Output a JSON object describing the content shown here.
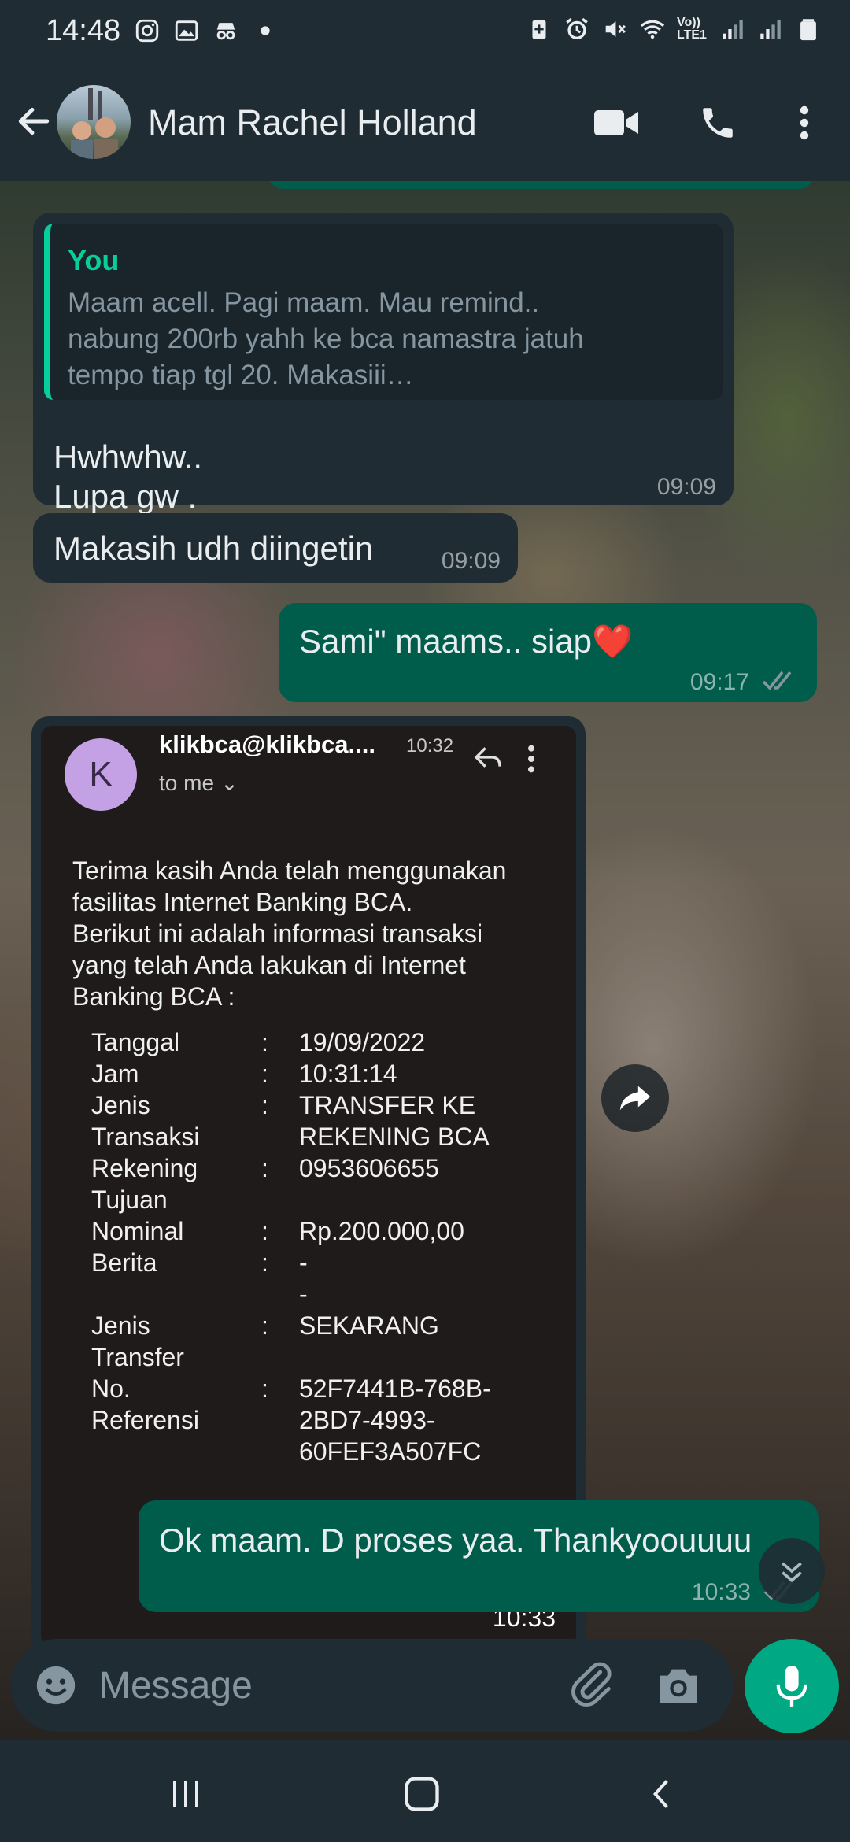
{
  "status_bar": {
    "time": "14:48",
    "left_icons": [
      "instagram-icon",
      "gallery-icon",
      "incognito-icon",
      "dot-icon"
    ],
    "right_icons": [
      "battery-saver-icon",
      "alarm-icon",
      "mute-icon",
      "wifi-icon",
      "volte-icon",
      "signal-icon",
      "signal-icon",
      "battery-icon"
    ],
    "volte_label": "Vo)) LTE1"
  },
  "header": {
    "contact_name": "Mam Rachel Holland",
    "icons": [
      "back-arrow-icon",
      "video-call-icon",
      "phone-icon",
      "more-vert-icon"
    ]
  },
  "messages": [
    {
      "direction": "in",
      "quote": {
        "author": "You",
        "lines": [
          "Maam acell. Pagi maam. Mau remind..",
          "nabung 200rb yahh ke bca namastra jatuh",
          "tempo tiap tgl 20. Makasiii…"
        ]
      },
      "lines": [
        "Hwhwhw..",
        "Lupa gw ."
      ],
      "time": "09:09"
    },
    {
      "direction": "in",
      "text": "Makasih udh diingetin",
      "time": "09:09"
    },
    {
      "direction": "out",
      "text": "Sami\" maams.. siap❤️",
      "time": "09:17",
      "status_icon": "double-check-icon"
    },
    {
      "direction": "in",
      "type": "image",
      "time": "10:33",
      "email": {
        "avatar_letter": "K",
        "from": "klikbca@klikbca....",
        "from_time": "10:32",
        "to": "to me ⌄",
        "body_lines": [
          "Terima kasih Anda telah menggunakan",
          "fasilitas Internet Banking BCA.",
          "Berikut ini adalah informasi transaksi",
          "yang telah Anda lakukan di Internet",
          "Banking BCA :"
        ],
        "details": [
          {
            "label": "Tanggal",
            "value": "19/09/2022"
          },
          {
            "label": "Jam",
            "value": "10:31:14"
          },
          {
            "label": "Jenis\nTransaksi",
            "value": "TRANSFER KE\nREKENING BCA"
          },
          {
            "label": "Rekening\nTujuan",
            "value": "0953606655"
          },
          {
            "label": "Nominal",
            "value": "Rp.200.000,00"
          },
          {
            "label": "Berita",
            "value": "-\n-"
          },
          {
            "label": "Jenis\nTransfer",
            "value": "SEKARANG"
          },
          {
            "label": "No.\nReferensi",
            "value": "52F7441B-768B-\n2BD7-4993-\n60FEF3A507FC"
          }
        ]
      }
    },
    {
      "direction": "out",
      "text": "Ok maam. D proses yaa. Thankyoouuuu",
      "time": "10:33",
      "status_icon": "double-check-icon"
    }
  ],
  "composer": {
    "placeholder": "Message",
    "icons": [
      "emoji-icon",
      "attach-icon",
      "camera-icon",
      "mic-icon"
    ]
  },
  "colors": {
    "header_bg": "#1f2c34",
    "incoming_bubble": "#1f2c34",
    "outgoing_bubble": "#005c4b",
    "accent": "#00a884",
    "quote_author": "#06cf9c"
  }
}
